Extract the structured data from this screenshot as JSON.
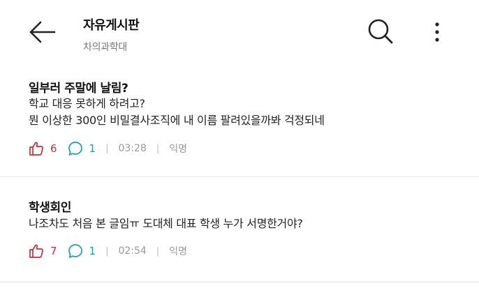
{
  "header": {
    "title": "자유게시판",
    "subtitle": "차의과학대",
    "back_icon": "arrow-left-icon",
    "search_icon": "search-icon",
    "more_icon": "more-vertical-icon"
  },
  "posts": [
    {
      "title": "일부러 주말에 날림?",
      "body_lines": [
        "학교 대응 못하게 하려고?",
        "뭔 이상한 300인 비밀결사조직에 내 이름 팔려있을까봐 걱정되네"
      ],
      "likes": "6",
      "comments": "1",
      "separator": "|",
      "time": "03:28",
      "author": "익명"
    },
    {
      "title": "학생회인",
      "body_lines": [
        "나조차도 처음 본 글임ㅠ 도대체 대표 학생 누가 서명한거야?"
      ],
      "likes": "7",
      "comments": "1",
      "separator": "|",
      "time": "02:54",
      "author": "익명"
    }
  ],
  "colors": {
    "like": "#c6303b",
    "comment": "#1aa3a3",
    "meta_gray": "#999999",
    "divider": "#e6e6e6"
  }
}
